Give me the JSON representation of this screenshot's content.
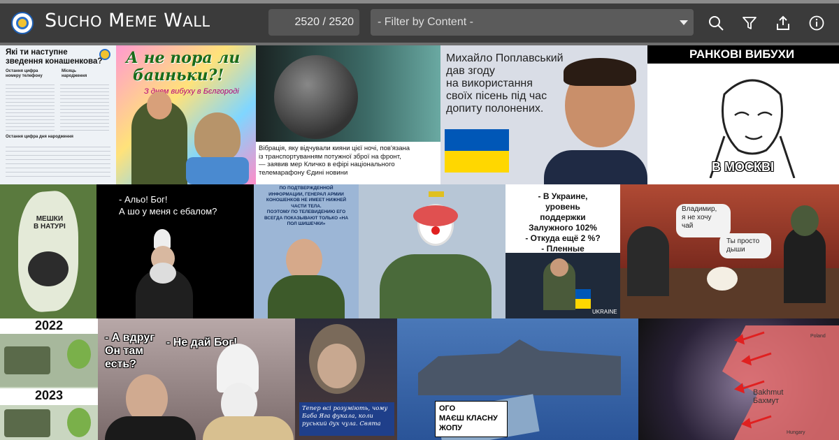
{
  "header": {
    "title_initial_1": "S",
    "title_rest_1": "UCHO",
    "title_initial_2": "M",
    "title_rest_2": "eme",
    "title_initial_3": "W",
    "title_rest_3": "all",
    "counter": "2520 / 2520",
    "filter_placeholder": "- Filter by Content -",
    "icons": [
      "search-icon",
      "filter-icon",
      "share-icon",
      "info-icon"
    ]
  },
  "memes": [
    {
      "id": "meme-1",
      "lines": [
        "Які ти наступне",
        "зведення конашенкова?"
      ],
      "sub": [
        "Остання цифра",
        "номеру телефону",
        "Місяць",
        "народження",
        "Остання цифра дня народження"
      ]
    },
    {
      "id": "meme-2",
      "lines": [
        "А не пора ли",
        "баиньки?!"
      ],
      "sub": [
        "З днем вибуху в Бєлгороді"
      ]
    },
    {
      "id": "meme-3",
      "lines": [
        "Вібрація, яку відчували кияни цієї ночі, пов'язана",
        "із транспортуванням потужної зброї на фронт,",
        "— заявив мер Кличко в ефірі національного",
        "телемарафону Єдині новини"
      ]
    },
    {
      "id": "meme-4",
      "lines": [
        "Михайло Поплавський",
        "дав згоду",
        "на використання",
        "своїх пісень під час",
        "допиту полонених."
      ]
    },
    {
      "id": "meme-5",
      "lines": [
        "РАНКОВІ ВИБУХИ",
        "В МОСКВІ"
      ]
    },
    {
      "id": "meme-6",
      "lines": [
        "МЕШКИ",
        "В НАТУРІ"
      ]
    },
    {
      "id": "meme-7",
      "lines": [
        "- Альо! Бог!",
        "А шо у меня с ебалом?"
      ]
    },
    {
      "id": "meme-8",
      "lines": [
        "ПО ПОДТВЕРЖДЕННОЙ",
        "ИНФОРМАЦИИ, ГЕНЕРАЛ АРМИИ",
        "КОНОШЕНКОВ НЕ ИМЕЕТ НИЖНЕЙ",
        "ЧАСТИ ТЕЛА.",
        "ПОЭТОМУ ПО ТЕЛЕВИДЕНИЮ ЕГО",
        "ВСЕГДА ПОКАЗЫВАЮТ ТОЛЬКО «НА",
        "ПОЛ ШИШЕЧКИ»"
      ]
    },
    {
      "id": "meme-9",
      "lines": []
    },
    {
      "id": "meme-10",
      "lines": [
        "- В Украине,",
        "уровень",
        "поддержки",
        "Залужного 102%",
        "- Откуда ещё 2 %?",
        "- Пленные"
      ],
      "sub": [
        "UKRAINE"
      ]
    },
    {
      "id": "meme-11",
      "lines": [
        "Владимир,",
        "я не хочу",
        "чай",
        "Ты просто",
        "дыши"
      ]
    },
    {
      "id": "meme-12",
      "lines": [
        "2022",
        "2023"
      ]
    },
    {
      "id": "meme-13",
      "lines": [
        "- А вдруг",
        "Он там",
        "есть?",
        "- Не дай Бог!"
      ]
    },
    {
      "id": "meme-14",
      "lines": [
        "Тепер всі розуміють, чому",
        "Баба Яга фукала, коли",
        "руський дух чула. Свята"
      ]
    },
    {
      "id": "meme-15",
      "lines": [
        "ОГО",
        "МАЄШ КЛАСНУ",
        "ЖОПУ"
      ]
    },
    {
      "id": "meme-16",
      "lines": [
        "Bakhmut",
        "Бахмут"
      ],
      "sub": [
        "Poland",
        "Hungary"
      ]
    }
  ],
  "colors": {
    "header_bg": "#3b3b3b",
    "accent": "#ffffff",
    "field_bg": "#555555"
  }
}
